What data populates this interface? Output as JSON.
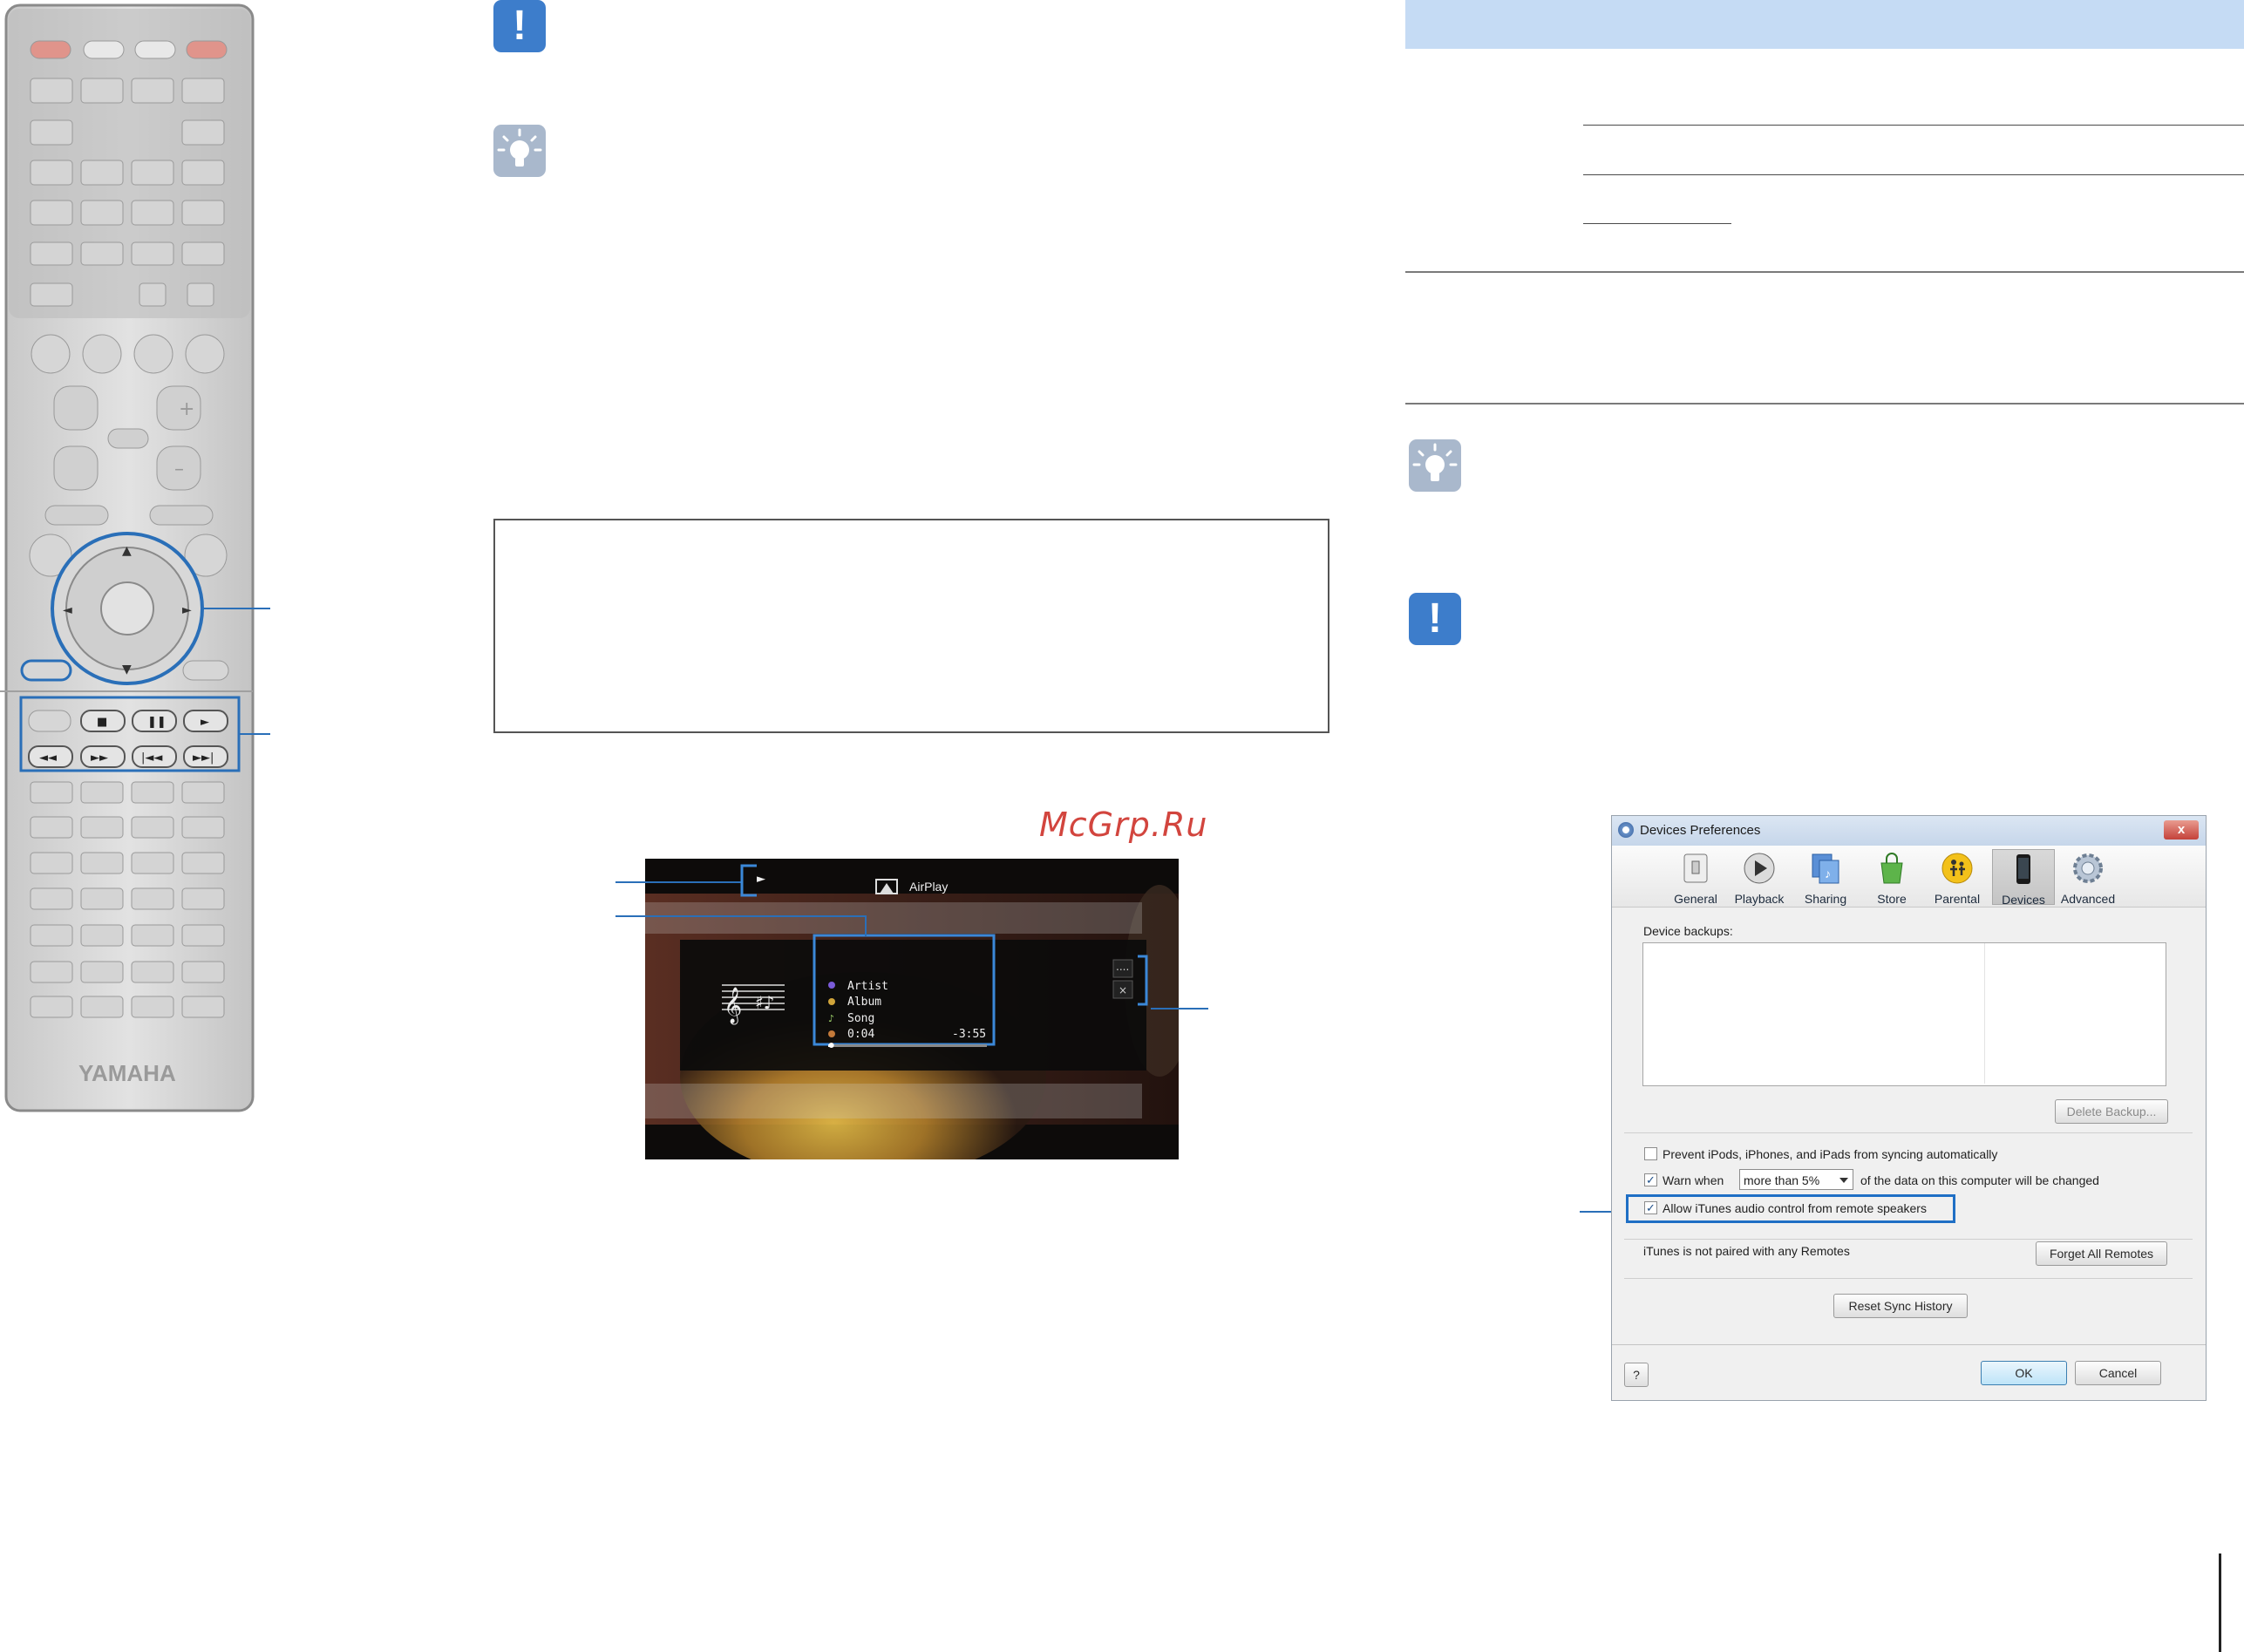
{
  "remote": {
    "brand": "YAMAHA"
  },
  "watermark": "McGrp.Ru",
  "airplay_screen": {
    "header": "AirPlay",
    "play_symbol": "►",
    "track": {
      "artist": "Artist",
      "album": "Album",
      "song": "Song"
    },
    "elapsed": "0:04",
    "remaining": "-3:55",
    "progress": 0.02,
    "menu_symbol": "....",
    "close_symbol": "×"
  },
  "dialog": {
    "title": "Devices Preferences",
    "close_symbol": "x",
    "toolbar": [
      {
        "label": "General",
        "icon": "general-icon"
      },
      {
        "label": "Playback",
        "icon": "playback-icon"
      },
      {
        "label": "Sharing",
        "icon": "sharing-icon"
      },
      {
        "label": "Store",
        "icon": "store-icon"
      },
      {
        "label": "Parental",
        "icon": "parental-icon"
      },
      {
        "label": "Devices",
        "icon": "devices-icon",
        "selected": true
      },
      {
        "label": "Advanced",
        "icon": "advanced-icon"
      }
    ],
    "device_backups_label": "Device backups:",
    "delete_backup_button": "Delete Backup...",
    "prevent_sync_label": "Prevent iPods, iPhones, and iPads from syncing automatically",
    "prevent_sync_checked": false,
    "warn_when_label": "Warn when",
    "warn_when_checked": true,
    "warn_select_value": "more than 5%",
    "warn_suffix": "of the data on this computer will be changed",
    "allow_remote_label": "Allow iTunes audio control from remote speakers",
    "allow_remote_checked": true,
    "remotes_status": "iTunes is not paired with any Remotes",
    "forget_remotes_button": "Forget All Remotes",
    "reset_sync_button": "Reset Sync History",
    "help_button": "?",
    "ok_button": "OK",
    "cancel_button": "Cancel",
    "check_mark": "✓"
  },
  "colors": {
    "accent_blue": "#3d7dcb",
    "table_header": "#c5dbf4",
    "callout_blue": "#2a6fb8",
    "watermark_red": "#d2453e"
  }
}
